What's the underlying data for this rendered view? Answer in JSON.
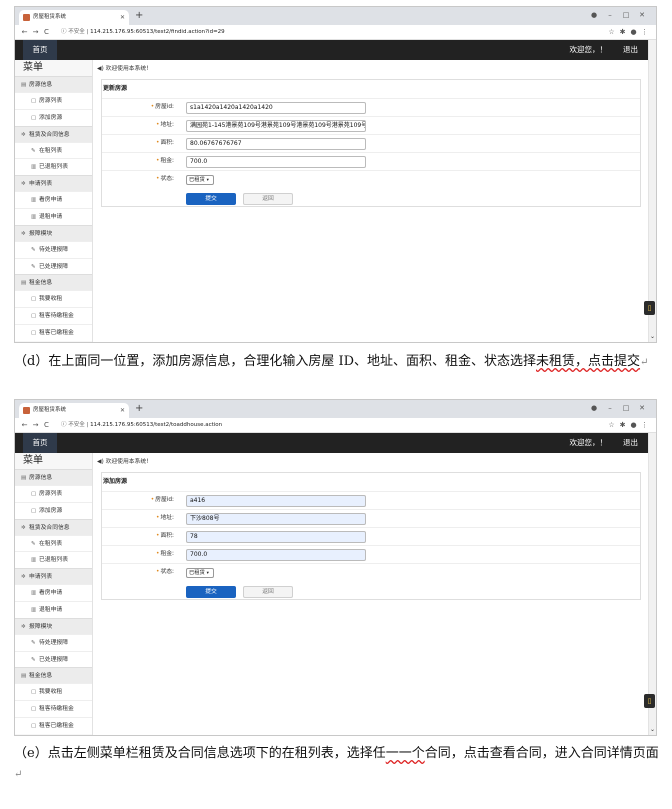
{
  "shots": [
    {
      "tab_title": "房屋租赁系统",
      "address_insecure": "不安全",
      "url": "114.215.176.95:60513/test2/findid.action?id=29",
      "home_label": "首页",
      "welcome": "欢迎您，！",
      "logout": "退出",
      "menu_title": "菜单",
      "menu": [
        {
          "label": "房源信息",
          "items": [
            "房源列表",
            "添加房源"
          ]
        },
        {
          "label": "租赁及合同信息",
          "items": [
            "在租列表",
            "已退租列表"
          ]
        },
        {
          "label": "申请列表",
          "items": [
            "看房申请",
            "退租申请"
          ]
        },
        {
          "label": "报障模块",
          "items": [
            "待处理报障",
            "已处理报障"
          ]
        },
        {
          "label": "租金信息",
          "items": [
            "我要收租",
            "租客待缴租金",
            "租客已缴租金"
          ]
        }
      ],
      "notice": "欢迎使用本系统!",
      "form_title": "更新房源",
      "fields": [
        {
          "label": "房屋id:",
          "value": "s1a1420a1420a1420a1420"
        },
        {
          "label": "地址:",
          "value": "满园苑1-145港景苑109号港景苑109号港景苑109号港景苑109号"
        },
        {
          "label": "面积:",
          "value": "80.06767676767"
        },
        {
          "label": "租金:",
          "value": "700.0"
        }
      ],
      "status_label": "状态:",
      "status_value": "已租赁",
      "submit": "提交",
      "cancel": "返回"
    },
    {
      "tab_title": "房屋租赁系统",
      "address_insecure": "不安全",
      "url": "114.215.176.95:60513/test2/toaddhouse.action",
      "home_label": "首页",
      "welcome": "欢迎您，！",
      "logout": "退出",
      "menu_title": "菜单",
      "menu": [
        {
          "label": "房源信息",
          "items": [
            "房源列表",
            "添加房源"
          ]
        },
        {
          "label": "租赁及合同信息",
          "items": [
            "在租列表",
            "已退租列表"
          ]
        },
        {
          "label": "申请列表",
          "items": [
            "看房申请",
            "退租申请"
          ]
        },
        {
          "label": "报障模块",
          "items": [
            "待处理报障",
            "已处理报障"
          ]
        },
        {
          "label": "租金信息",
          "items": [
            "我要收租",
            "租客待缴租金",
            "租客已缴租金"
          ]
        }
      ],
      "notice": "欢迎使用本系统!",
      "form_title": "添加房源",
      "fields": [
        {
          "label": "房屋id:",
          "value": "a416"
        },
        {
          "label": "地址:",
          "value": "下沙808号"
        },
        {
          "label": "面积:",
          "value": "78"
        },
        {
          "label": "租金:",
          "value": "700.0"
        }
      ],
      "status_label": "状态:",
      "status_value": "已租赁",
      "submit": "提交",
      "cancel": "返回"
    }
  ],
  "captions": {
    "c1_pre": "（d）在上面同一位置，添加房源信息，合理化输入房屋 ID、地址、面积、租金、状态选择",
    "c1_ul": "未租赁，点击提交",
    "c2_pre": "（e）点击左侧菜单栏租赁及合同信息选项下的在租列表，选择任",
    "c2_ul": "一一个",
    "c2_post": "合同，点击查看合同，进入合同详情页面"
  }
}
